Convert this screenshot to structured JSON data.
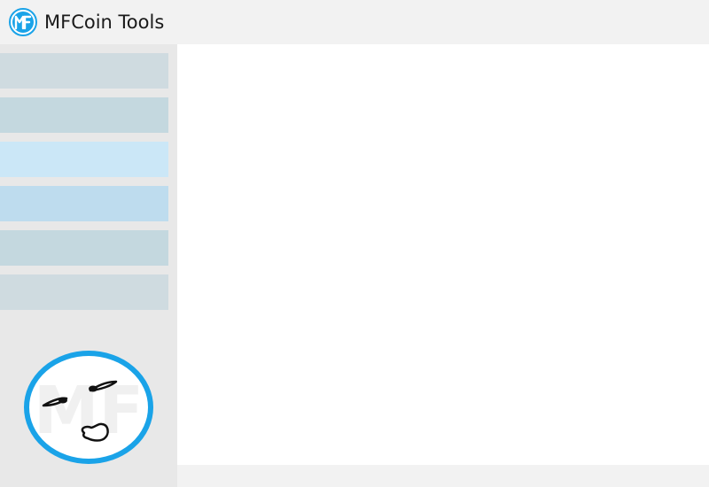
{
  "app": {
    "title": "MFCoin Tools",
    "logo_icon": "mfcoin-logo-icon",
    "logo_lettering": "MF",
    "accent_color": "#1aa3e8"
  },
  "sidebar": {
    "items": [
      {
        "label": "",
        "color": "#cfdbe0"
      },
      {
        "label": "",
        "color": "#c4d8df"
      },
      {
        "label": "",
        "color": "#cbe7f7"
      },
      {
        "label": "",
        "color": "#bedcee"
      },
      {
        "label": "",
        "color": "#c4d8df"
      },
      {
        "label": "",
        "color": "#cfdbe0"
      }
    ],
    "mascot_icon": "mfcoin-mascot-icon",
    "mascot_lettering": "MF"
  }
}
